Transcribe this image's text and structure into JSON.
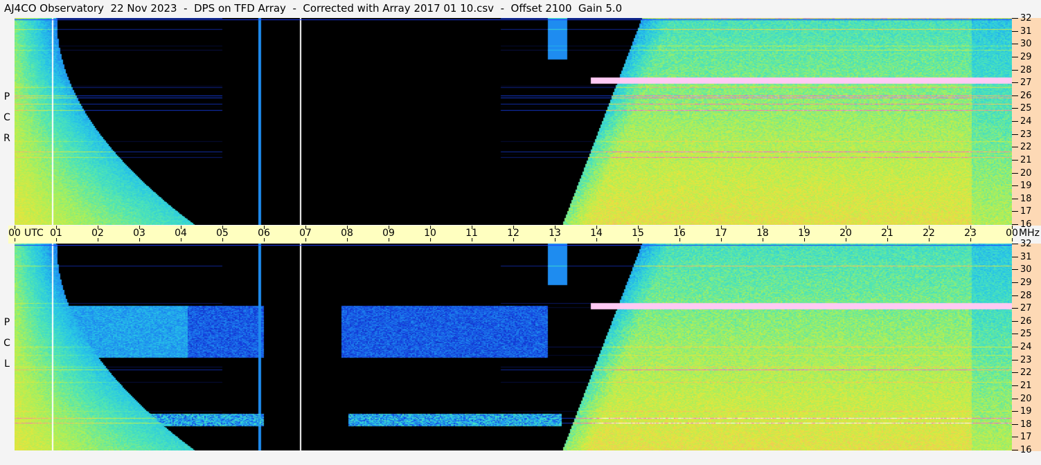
{
  "title": "AJ4CO Observatory  22 Nov 2023  -  DPS on TFD Array  -  Corrected with Array 2017 01 10.csv  -  Offset 2100  Gain 5.0",
  "chart_data": {
    "type": "heatmap",
    "title": "AJ4CO Observatory  22 Nov 2023  -  DPS on TFD Array  -  Corrected with Array 2017 01 10.csv  -  Offset 2100  Gain 5.0",
    "xlabel": "UTC",
    "ylabel": "MHz",
    "x_ticks": [
      "00",
      "01",
      "02",
      "03",
      "04",
      "05",
      "06",
      "07",
      "08",
      "09",
      "10",
      "11",
      "12",
      "13",
      "14",
      "15",
      "16",
      "17",
      "18",
      "19",
      "20",
      "21",
      "22",
      "23",
      "00"
    ],
    "xlim": [
      0,
      24
    ],
    "ylim": [
      16,
      32
    ],
    "y_ticks": [
      32,
      31,
      30,
      29,
      28,
      27,
      26,
      25,
      24,
      23,
      22,
      21,
      20,
      19,
      18,
      17,
      16
    ],
    "panels": [
      {
        "name": "RCP",
        "label": [
          "R",
          "C",
          "P"
        ]
      },
      {
        "name": "LCP",
        "label": [
          "L",
          "C",
          "P"
        ]
      }
    ]
  }
}
